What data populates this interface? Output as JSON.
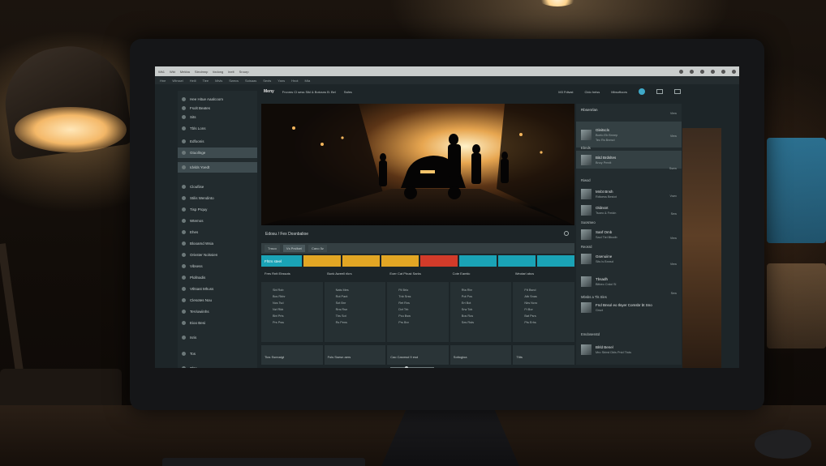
{
  "os_bar": {
    "items": [
      "Wk1",
      "Wkt",
      "Mekba",
      "Sleclmnp",
      "tixdong",
      "lnelt",
      "Srourp"
    ]
  },
  "menu_bar": {
    "items": [
      "Hne",
      "Wtrssel",
      "Heiil",
      "Tiee",
      "Mivls",
      "Swecs",
      "Soisaas",
      "Sexts",
      "Yans",
      "Hnot",
      "Mta"
    ]
  },
  "top_row": {
    "logo": "Meny",
    "title": "Frvoms Cl sess Sikl & Botcsns B: Bel",
    "tag": "Ssfes",
    "right_a": "M3 Fdiwst",
    "right_b": "Cldo heiss",
    "right_c": "Mbsoftoors"
  },
  "sidebar": {
    "items": [
      {
        "label": "Hee  Hitue Aaalcoom",
        "icon": "home-icon",
        "active": false
      },
      {
        "label": "Fsolt Beates",
        "icon": "grid-icon",
        "active": true
      },
      {
        "label": "Sits",
        "icon": "bars-icon",
        "active": false
      },
      {
        "label": "Tbls Lons",
        "icon": "list-icon",
        "active": false
      },
      {
        "label": "Edfoonis",
        "icon": "edit-icon",
        "active": false
      },
      {
        "label": "Gtuollnge",
        "icon": "users-icon",
        "active": true
      },
      {
        "label": "Idvlds Yoedt",
        "icon": "doc-icon",
        "active": true
      },
      {
        "label": "Cloufiise",
        "icon": "cloud-icon",
        "active": false
      },
      {
        "label": "Stilis Wendinto",
        "icon": "folder-icon",
        "active": false
      },
      {
        "label": "Tisp Prquy",
        "icon": "clock-icon",
        "active": false
      },
      {
        "label": "Wtemos",
        "icon": "star-icon",
        "active": false
      },
      {
        "label": "Ehes",
        "icon": "tag-icon",
        "active": false
      },
      {
        "label": "Blooamd Wsia",
        "icon": "box-icon",
        "active": false
      },
      {
        "label": "Orivster Nolssien",
        "icon": "chart-icon",
        "active": false
      },
      {
        "label": "Vibsess",
        "icon": "play-icon",
        "active": false
      },
      {
        "label": "Plollnadis",
        "icon": "mic-icon",
        "active": false
      },
      {
        "label": "Vtltsast Mhuss",
        "icon": "camera-icon",
        "active": false
      },
      {
        "label": "Clesotes Nou",
        "icon": "gear-icon",
        "active": false
      },
      {
        "label": "TeViowiinhs",
        "icon": "monitor-icon",
        "active": false
      },
      {
        "label": "Eioo Besi",
        "icon": "flag-icon",
        "active": false
      },
      {
        "label": "Isris",
        "icon": "info-icon",
        "active": false
      },
      {
        "label": "Tos",
        "icon": "dot-icon",
        "active": false
      },
      {
        "label": "Tbts",
        "icon": "search-icon",
        "active": false
      }
    ]
  },
  "editor": {
    "title": "Edosu / Fex Dosnbalioe",
    "track_tabs": [
      "Tnsco",
      "Vs Prslfoel",
      "Cano  5z"
    ],
    "colors": [
      "#1aa3b6",
      "#e2a624",
      "#e2a624",
      "#e2a624",
      "#d23b2a",
      "#1aa3b6",
      "#1aa3b6",
      "#1aa3b6"
    ],
    "first_label": "Fhtrs steel",
    "columns": [
      "Fres Rntt Ebssots",
      "Bunk Aweell rikrs",
      "Eoer Cat Phust Sarks",
      "Cote Eamtic",
      "Weotarl abcs"
    ],
    "rows": [
      [
        "Sbl Rob",
        "Nats Mes",
        "Ftl Brlo",
        "Rta Rbr",
        "Ftt Bsnd"
      ],
      [
        "Bcs Rbhr",
        "Rot Pant",
        "Tnb Srss",
        "Pot Pos",
        "Atb Snas"
      ],
      [
        "Ncs Tsd",
        "Sot Bnr",
        "Ret Rns",
        "Ert Bot",
        "Nbs Ncro"
      ],
      [
        "Nzl Rkb",
        "Rns Rsn",
        "Dvt Trb",
        "Srw Tcb",
        "Ft Bor"
      ],
      [
        "Bbt Prts",
        "Tbs Sot",
        "Pcu Bsw",
        "Bos Ros",
        "Bat Psrs"
      ],
      [
        "Prs Pws",
        "Rs Pens",
        "Prs Bnr",
        "Ses Rsts",
        "Pts Erhs"
      ]
    ],
    "footer": [
      "Tios Ssnnaigt",
      "Fols Ssesn aers",
      "Cao Casmsd 9 esd",
      "Soltogioa",
      "Ttits"
    ]
  },
  "right_panel": {
    "header": "Rbsenrlan",
    "items": [
      {
        "title": "Gleitscls",
        "sub": "Bcelo Eb Bnnep",
        "sub2": "Tec Rs Bnnsd",
        "highlight": true
      },
      {
        "title": "Bitd Brdsltes",
        "sub": "Bnoy Pmnlt",
        "highlight": true
      },
      {
        "title": "Mnbt Bnsh",
        "sub": "Rdtoess Bestot",
        "highlight": false
      },
      {
        "title": "Oldnsnt",
        "sub": "Tsoeo & Fmidn",
        "highlight": false
      },
      {
        "title": "Sanf Omb",
        "sub": "Saol Tiel Bbodb",
        "highlight": false
      },
      {
        "title": "Gsenuiine",
        "sub": "Sits ls Bnnsd",
        "highlight": false
      },
      {
        "title": "Tbsadh",
        "sub": "Bitbeo Crdol Sl",
        "highlight": false
      },
      {
        "title": "Fnd Bnsol eo Ilsyer Comsbr bt Sno",
        "sub": "Grsct",
        "highlight": false
      },
      {
        "title": "Blrld Benel",
        "sub": "Mro Sbirst Dbls Pnld Tbds",
        "highlight": false
      }
    ],
    "sections": [
      "Ebnds",
      "Riwod",
      "Suosmeo",
      "Reosrd",
      "Mbsbs a Tls Sles",
      "Emdosesstd"
    ],
    "view_labels": [
      "View",
      "View",
      "Ssew",
      "Vsev",
      "Sew",
      "View",
      "View",
      "Sew"
    ]
  }
}
